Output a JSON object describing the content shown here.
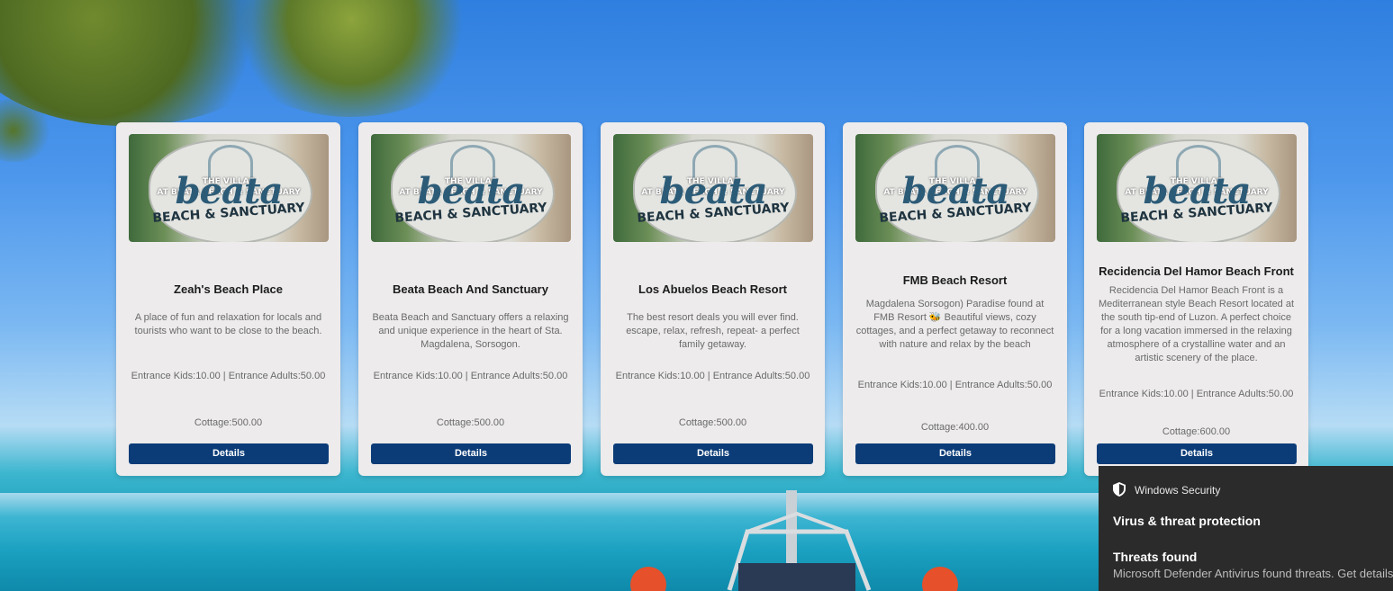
{
  "cards": [
    {
      "title": "Zeah's Beach Place",
      "description": "A place of fun and relaxation for locals and tourists who want to be close to the beach.",
      "entrance": "Entrance Kids:10.00 | Entrance Adults:50.00",
      "cottage": "Cottage:500.00",
      "button": "Details",
      "image_text": {
        "small": "THE VILLAS",
        "small2": "AT BEATA BEACH & SANCTUARY",
        "big": "beata",
        "sub": "BEACH & SANCTUARY"
      }
    },
    {
      "title": "Beata Beach And Sanctuary",
      "description": "Beata Beach and Sanctuary offers a relaxing and unique experience in the heart of Sta. Magdalena, Sorsogon.",
      "entrance": "Entrance Kids:10.00 | Entrance Adults:50.00",
      "cottage": "Cottage:500.00",
      "button": "Details",
      "image_text": {
        "small": "THE VILLAS",
        "small2": "AT BEATA BEACH & SANCTUARY",
        "big": "beata",
        "sub": "BEACH & SANCTUARY"
      }
    },
    {
      "title": "Los Abuelos Beach Resort",
      "description": "The best resort deals you will ever find. escape, relax, refresh, repeat- a perfect family getaway.",
      "entrance": "Entrance Kids:10.00 | Entrance Adults:50.00",
      "cottage": "Cottage:500.00",
      "button": "Details",
      "image_text": {
        "small": "THE VILLAS",
        "small2": "AT BEATA BEACH & SANCTUARY",
        "big": "beata",
        "sub": "BEACH & SANCTUARY"
      }
    },
    {
      "title": "FMB Beach Resort",
      "description": "Magdalena Sorsogon) Paradise found at FMB Resort 🐝 Beautiful views, cozy cottages, and a perfect getaway to reconnect with nature and relax by the beach",
      "entrance": "Entrance Kids:10.00 | Entrance Adults:50.00",
      "cottage": "Cottage:400.00",
      "button": "Details",
      "image_text": {
        "small": "THE VILLAS",
        "small2": "AT BEATA BEACH & SANCTUARY",
        "big": "beata",
        "sub": "BEACH & SANCTUARY"
      }
    },
    {
      "title": "Recidencia Del Hamor Beach Front",
      "description": "Recidencia Del Hamor Beach Front is a Mediterranean style Beach Resort located at the south tip-end of Luzon. A perfect choice for a long vacation immersed in the relaxing atmosphere of a crystalline water and an artistic scenery of the place.",
      "entrance": "Entrance Kids:10.00 | Entrance Adults:50.00",
      "cottage": "Cottage:600.00",
      "button": "Details",
      "image_text": {
        "small": "THE VILLAS",
        "small2": "AT BEATA BEACH & SANCTUARY",
        "big": "beata",
        "sub": "BEACH & SANCTUARY"
      }
    }
  ],
  "toast": {
    "app_name": "Windows Security",
    "heading": "Virus & threat protection",
    "subheading": "Threats found",
    "message": "Microsoft Defender Antivirus found threats. Get details."
  },
  "colors": {
    "button_bg": "#0b3c78",
    "card_bg": "#edebec",
    "toast_bg": "#2b2b2b"
  }
}
